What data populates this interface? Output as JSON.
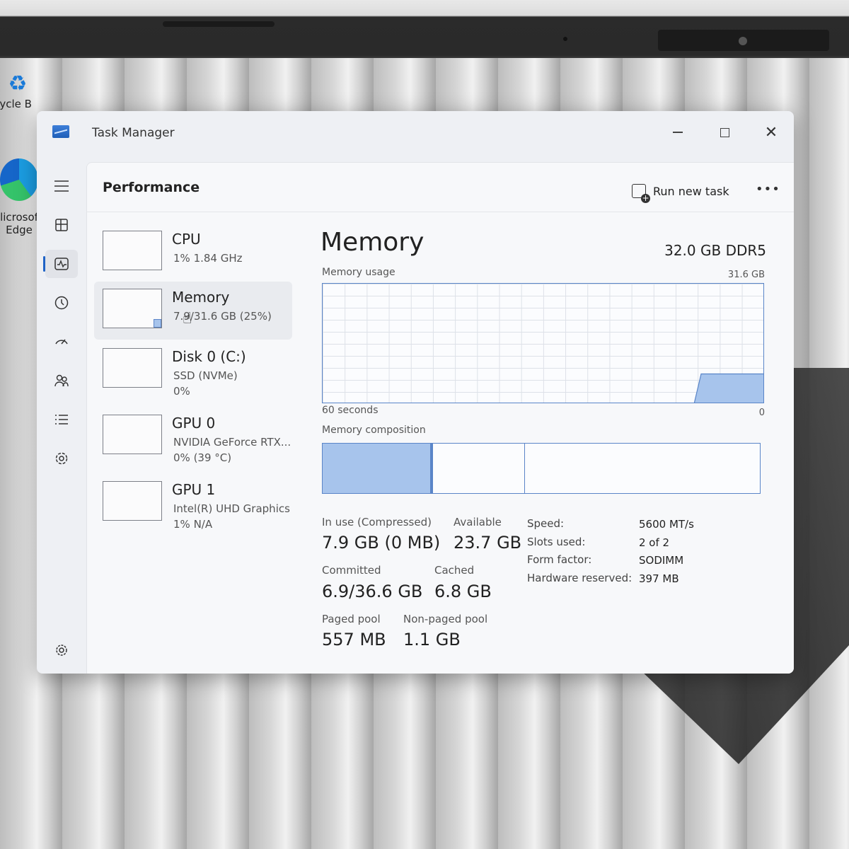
{
  "desktop": {
    "recycle_label": "cycle B",
    "edge_label_1": "licrosof",
    "edge_label_2": "Edge"
  },
  "window": {
    "title": "Task Manager",
    "minimize": "—",
    "close": "✕"
  },
  "nav": {
    "items": [
      "menu-icon",
      "processes-icon",
      "performance-icon",
      "app-history-icon",
      "startup-apps-icon",
      "users-icon",
      "details-icon",
      "services-icon"
    ],
    "settings": "settings-icon",
    "active": "performance-icon"
  },
  "header": {
    "title": "Performance",
    "run_new_task": "Run new task",
    "more": "•••"
  },
  "devices": [
    {
      "name": "CPU",
      "line1": "1%  1.84 GHz",
      "line2": ""
    },
    {
      "name": "Memory",
      "line1": "7.9/31.6 GB (25%)",
      "line2": ""
    },
    {
      "name": "Disk 0 (C:)",
      "line1": "SSD (NVMe)",
      "line2": "0%"
    },
    {
      "name": "GPU 0",
      "line1": "NVIDIA GeForce RTX...",
      "line2": "0%  (39 °C)"
    },
    {
      "name": "GPU 1",
      "line1": "Intel(R) UHD Graphics",
      "line2": "1%  N/A"
    }
  ],
  "memory": {
    "title": "Memory",
    "spec": "32.0 GB DDR5",
    "usage_label": "Memory usage",
    "usage_max": "31.6 GB",
    "axis_left": "60 seconds",
    "axis_right": "0",
    "usage_fraction": 0.25,
    "composition_label": "Memory composition",
    "composition": {
      "in_use": 0.25,
      "standby": 0.21,
      "free": 0.54
    },
    "stats": {
      "in_use_label": "In use (Compressed)",
      "in_use_value": "7.9 GB (0 MB)",
      "available_label": "Available",
      "available_value": "23.7 GB",
      "committed_label": "Committed",
      "committed_value": "6.9/36.6 GB",
      "cached_label": "Cached",
      "cached_value": "6.8 GB",
      "paged_label": "Paged pool",
      "paged_value": "557 MB",
      "nonpaged_label": "Non-paged pool",
      "nonpaged_value": "1.1 GB"
    },
    "props": [
      {
        "label": "Speed:",
        "value": "5600 MT/s"
      },
      {
        "label": "Slots used:",
        "value": "2 of 2"
      },
      {
        "label": "Form factor:",
        "value": "SODIMM"
      },
      {
        "label": "Hardware reserved:",
        "value": "397 MB"
      }
    ]
  },
  "colors": {
    "accent": "#1f63c6",
    "graph_fill": "#a7c4ec",
    "graph_line": "#5a85c8"
  }
}
